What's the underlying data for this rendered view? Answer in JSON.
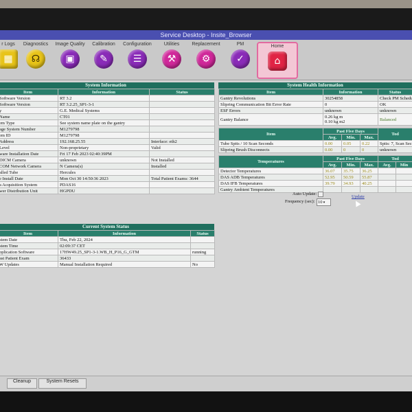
{
  "window": {
    "title": "Service Desktop - Insite_Browser"
  },
  "toolbar": {
    "items": [
      {
        "label": "r Logs",
        "icon": "logs-icon"
      },
      {
        "label": "Diagnostics",
        "icon": "stethoscope-icon"
      },
      {
        "label": "Image Quality",
        "icon": "image-quality-icon"
      },
      {
        "label": "Calibration",
        "icon": "calibration-icon"
      },
      {
        "label": "Configuration",
        "icon": "configuration-icon"
      },
      {
        "label": "Utilities",
        "icon": "utilities-icon"
      },
      {
        "label": "Replacement",
        "icon": "replacement-icon"
      },
      {
        "label": "PM",
        "icon": "pm-clipboard-icon"
      },
      {
        "label": "Home",
        "icon": "home-icon"
      }
    ]
  },
  "system_info": {
    "title": "System Information",
    "headers": [
      "Item",
      "Information",
      "Status"
    ],
    "rows": [
      [
        "Software Version",
        "RT 3.2",
        ""
      ],
      [
        "Software Version",
        "RT 3.2.25_SP1-3-1",
        ""
      ],
      [
        "y",
        "G.E. Medical Systems",
        ""
      ],
      [
        "Name",
        "CT01",
        ""
      ],
      [
        "em Type",
        "See system name plate on the gantry",
        ""
      ],
      [
        "age System Number",
        "M1279798",
        ""
      ],
      [
        "em ID",
        "M1279798",
        ""
      ],
      [
        "Address",
        "192.168.25.55",
        "Interface: eth2"
      ],
      [
        "Level",
        "Non-proprietary",
        "Valid"
      ],
      [
        "ware Installation Date",
        "Fri 17 Feb 2023 02:40:39PM",
        ""
      ],
      [
        "DICM Camera",
        "unknown",
        "Not Installed"
      ],
      [
        "COM Network Camera",
        "N Camera(s)",
        "Installed"
      ],
      [
        "alled Tube",
        "Hercules",
        ""
      ],
      [
        "e Install Date",
        "Mon Oct 30 14:50:36 2023",
        "Total Patient Exams: 3644"
      ],
      [
        "a Acquisition System",
        "PDAS16",
        ""
      ],
      [
        "wer Distribution Unit",
        "HGPDU",
        ""
      ]
    ]
  },
  "current_status": {
    "title": "Current System Status",
    "headers": [
      "Item",
      "Information",
      "Status"
    ],
    "rows": [
      [
        "stem Date",
        "Thu, Feb 22, 2024",
        ""
      ],
      [
        "stem Time",
        "02:09:37 CET",
        ""
      ],
      [
        "pplication Software",
        "17HW49.25_SP1-3-1.WB_H_P16_G_GTM",
        "running"
      ],
      [
        "ast Patient Exam",
        "36433",
        ""
      ],
      [
        "W Updates",
        "Manual Installation Required",
        "No"
      ]
    ]
  },
  "health_info": {
    "title": "System Health Information",
    "headers": [
      "Item",
      "Information",
      "Status"
    ],
    "rows": [
      [
        "Gantry Revolutions",
        "30254858",
        "Check PM Schedu"
      ],
      [
        "Slipring Communication Bit Error Rate",
        "0",
        "OK"
      ],
      [
        "ESF Errors",
        "unknown",
        "unknown"
      ],
      [
        "Gantry Balance",
        "0.26 kg m\n0.10 kg m2",
        "Balanced"
      ]
    ]
  },
  "tube_spits": {
    "past_label": "Past Five Days",
    "headers": [
      "Item",
      "Avg.",
      "Min.",
      "Max.",
      "Tod"
    ],
    "rows": [
      [
        "Tube Spits / 10 Scan Seconds",
        "0.00",
        "0.05",
        "0.22",
        "Spits: 7, Scan Secon"
      ],
      [
        "Slipring Brush Disconnects",
        "0.00",
        "0",
        "0",
        "unknown"
      ]
    ]
  },
  "temperatures": {
    "title": "Temperatures",
    "past_label": "Past Five Days",
    "today_label": "Tod",
    "headers": [
      "Avg.",
      "Min.",
      "Max.",
      "Avg.",
      "Min"
    ],
    "rows": [
      [
        "Detector Temperatures",
        "36.07",
        "35.75",
        "36.25"
      ],
      [
        "DAS ADB Temperatures",
        "52.95",
        "50.59",
        "55.87"
      ],
      [
        "DAS IFB Temperatures",
        "39.79",
        "34.93",
        "40.25"
      ],
      [
        "Gantry Ambient Temperatures",
        "",
        "",
        ""
      ]
    ]
  },
  "auto_update": {
    "label": "Auto Update:",
    "frequency_label": "Frequency (sec):",
    "frequency_value": "10",
    "update_link": "Update"
  },
  "bottom": {
    "cleanup": "Cleanup",
    "system_resets": "System Resets"
  },
  "colors": {
    "header": "#2a7f6c",
    "home_tab": "#e02445",
    "title_bar": "#4a4fb0"
  }
}
